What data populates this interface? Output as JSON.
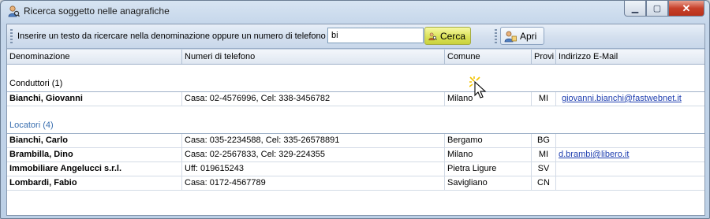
{
  "window": {
    "title": "Ricerca soggetto nelle anagrafiche",
    "buttons": {
      "minimize": "▭",
      "maximize": "□",
      "close": "✕"
    }
  },
  "toolbar": {
    "label": "Inserire un testo da ricercare nella denominazione oppure un numero di telefono",
    "search_value": "bi",
    "search_label": "Cerca",
    "open_label": "Apri"
  },
  "columns": [
    "Denominazione",
    "Numeri di telefono",
    "Comune",
    "Provi",
    "Indirizzo E-Mail"
  ],
  "groups": [
    {
      "title": "Conduttori (1)",
      "rows": [
        {
          "name": "Bianchi, Giovanni",
          "phones": "Casa: 02-4576996, Cel: 338-3456782",
          "city": "Milano",
          "prov": "MI",
          "email": "giovanni.bianchi@fastwebnet.it"
        }
      ]
    },
    {
      "title": "Locatori (4)",
      "rows": [
        {
          "name": "Bianchi, Carlo",
          "phones": "Casa: 035-2234588, Cel: 335-26578891",
          "city": "Bergamo",
          "prov": "BG",
          "email": ""
        },
        {
          "name": "Brambilla, Dino",
          "phones": "Casa: 02-2567833, Cel: 329-224355",
          "city": "Milano",
          "prov": "MI",
          "email": "d.brambi@libero.it"
        },
        {
          "name": "Immobiliare Angelucci s.r.l.",
          "phones": "Uff: 019615243",
          "city": "Pietra Ligure",
          "prov": "SV",
          "email": ""
        },
        {
          "name": "Lombardi, Fabio",
          "phones": "Casa: 0172-4567789",
          "city": "Savigliano",
          "prov": "CN",
          "email": ""
        }
      ]
    }
  ],
  "colors": {
    "accent": "#3a6fb0",
    "search_button": "#dbe25a",
    "link": "#1f3fb0"
  }
}
